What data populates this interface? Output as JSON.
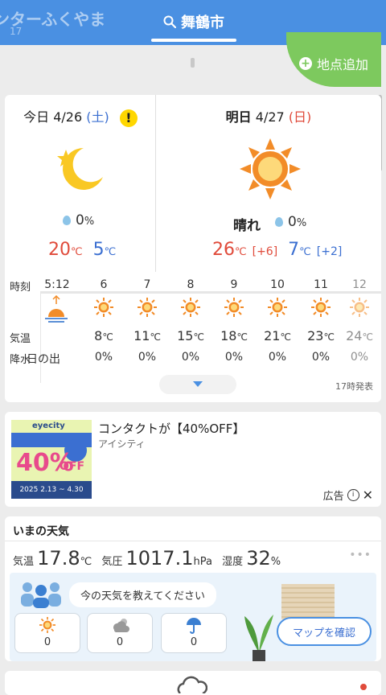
{
  "header": {
    "ghost_title": "ンターふくやま",
    "ghost_sub": "17",
    "active_tab": "舞鶴市",
    "add_location": "地点追加"
  },
  "today": {
    "label": "今日",
    "date": "4/26",
    "weekday": "(土)",
    "alert": "!",
    "icon": "moon-star-icon",
    "precip": "0",
    "precip_unit": "%",
    "high": "20",
    "low": "5",
    "temp_unit": "℃"
  },
  "tomorrow": {
    "label": "明日",
    "date": "4/27",
    "weekday": "(日)",
    "icon": "sun-icon",
    "weather": "晴れ",
    "precip": "0",
    "precip_unit": "%",
    "high": "26",
    "high_diff": "[+6]",
    "low": "7",
    "low_diff": "[+2]",
    "temp_unit": "℃"
  },
  "hourly": {
    "row_labels": {
      "time": "時刻",
      "temp": "気温",
      "precip": "降水"
    },
    "sunrise": {
      "time": "5:12",
      "label": "日の出"
    },
    "hours": [
      {
        "time": "6",
        "temp": "8",
        "precip": "0%"
      },
      {
        "time": "7",
        "temp": "11",
        "precip": "0%"
      },
      {
        "time": "8",
        "temp": "15",
        "precip": "0%"
      },
      {
        "time": "9",
        "temp": "18",
        "precip": "0%"
      },
      {
        "time": "10",
        "temp": "21",
        "precip": "0%"
      },
      {
        "time": "11",
        "temp": "23",
        "precip": "0%"
      },
      {
        "time": "12",
        "temp": "24",
        "precip": "0%"
      }
    ],
    "temp_unit": "℃",
    "announced": "17時発表"
  },
  "ad": {
    "title": "コンタクトが【40%OFF】",
    "sponsor": "アイシティ",
    "label": "広告",
    "image_logo": "eyecity",
    "image_big": "40%",
    "image_off": "OFF",
    "image_dates": "2025 2.13 ~ 4.30"
  },
  "now": {
    "heading": "いまの天気",
    "temp_label": "気温",
    "temp": "17.8",
    "temp_unit": "℃",
    "pressure_label": "気圧",
    "pressure": "1017.1",
    "pressure_unit": "hPa",
    "humidity_label": "湿度",
    "humidity": "32",
    "humidity_unit": "%",
    "more": "•••",
    "prompt": "今の天気を教えてください",
    "reports": [
      {
        "icon": "sun-icon",
        "count": "0"
      },
      {
        "icon": "cloud-icon",
        "count": "0"
      },
      {
        "icon": "umbrella-icon",
        "count": "0"
      }
    ],
    "map_button": "マップを確認"
  },
  "colors": {
    "header": "#4a90e2",
    "add": "#7dc95e",
    "high": "#e04b3b",
    "low": "#3b6fd1",
    "sun": "#f28c28"
  }
}
